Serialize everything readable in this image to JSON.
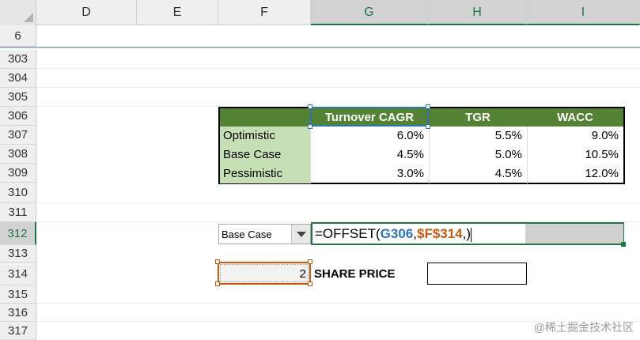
{
  "columns": [
    "D",
    "E",
    "F",
    "G",
    "H",
    "I"
  ],
  "frozen_row": "6",
  "rows": [
    "303",
    "304",
    "305",
    "306",
    "307",
    "308",
    "309",
    "310",
    "311",
    "312",
    "313",
    "314",
    "315",
    "316",
    "317"
  ],
  "selected_row": "312",
  "table": {
    "headers": [
      "Turnover CAGR",
      "TGR",
      "WACC"
    ],
    "scenarios": [
      {
        "label": "Optimistic",
        "values": [
          "6.0%",
          "5.5%",
          "9.0%"
        ]
      },
      {
        "label": "Base Case",
        "values": [
          "4.5%",
          "5.0%",
          "10.5%"
        ]
      },
      {
        "label": "Pessimistic",
        "values": [
          "3.0%",
          "4.5%",
          "12.0%"
        ]
      }
    ]
  },
  "dropdown": {
    "selected": "Base Case"
  },
  "formula": {
    "prefix": "=OFFSET(",
    "ref1": "G306",
    "sep": ",",
    "ref2": "$F$314",
    "suffix": ",)"
  },
  "linked_cell": {
    "value": "2"
  },
  "share_price_label": "SHARE PRICE",
  "watermark": "@稀土掘金技术社区",
  "colors": {
    "header_green": "#548235",
    "label_green": "#c6dfb4",
    "selection_green": "#217346",
    "ref_blue": "#2e75b6",
    "ref_orange": "#c55a11"
  }
}
